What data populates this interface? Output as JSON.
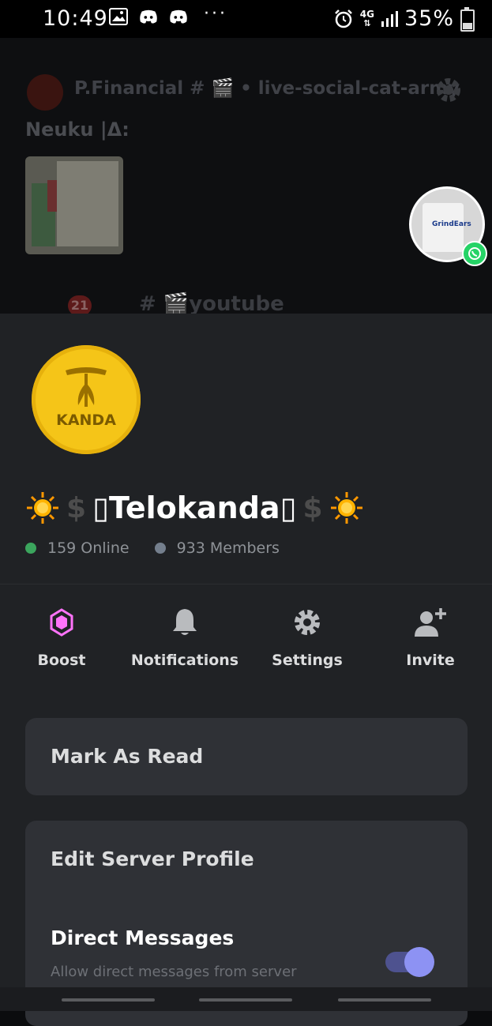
{
  "status_bar": {
    "time": "10:49",
    "network": "4G",
    "battery": "35%",
    "battery_level": 0.35,
    "icons": [
      "gallery-icon",
      "discord-icon",
      "discord-icon",
      "more-dots-icon",
      "alarm-icon",
      "network-4g-icon",
      "signal-icon",
      "battery-icon"
    ]
  },
  "background": {
    "channel_header": "P.Financial # 🎬 • live-social-cat-army",
    "message_author": "Neuku |Δ:",
    "unread_badge": "21",
    "channel_name": "# 🎬youtube"
  },
  "bubble": {
    "mug_label": "GrindEars"
  },
  "server": {
    "icon_text": "KANDA",
    "name_prefix_emoji": "☀️",
    "name_dollar": "$",
    "name": "▯Telokanda▯",
    "online": "159 Online",
    "members": "933 Members",
    "online_color": "#3ba55d",
    "members_color": "#747f8d"
  },
  "actions": [
    {
      "label": "Boost",
      "icon": "boost-icon"
    },
    {
      "label": "Notifications",
      "icon": "bell-icon"
    },
    {
      "label": "Settings",
      "icon": "gear-icon"
    },
    {
      "label": "Invite",
      "icon": "add-user-icon"
    }
  ],
  "menu": {
    "mark_as_read": "Mark As Read",
    "edit_server_profile": "Edit Server Profile",
    "direct_messages": "Direct Messages",
    "direct_messages_desc": "Allow direct messages from server members.",
    "direct_messages_enabled": true
  },
  "colors": {
    "boost": "#ff73fa",
    "toggle_on": "#8d92f3",
    "sheet_bg": "#202225",
    "card_bg": "#2f3136"
  }
}
